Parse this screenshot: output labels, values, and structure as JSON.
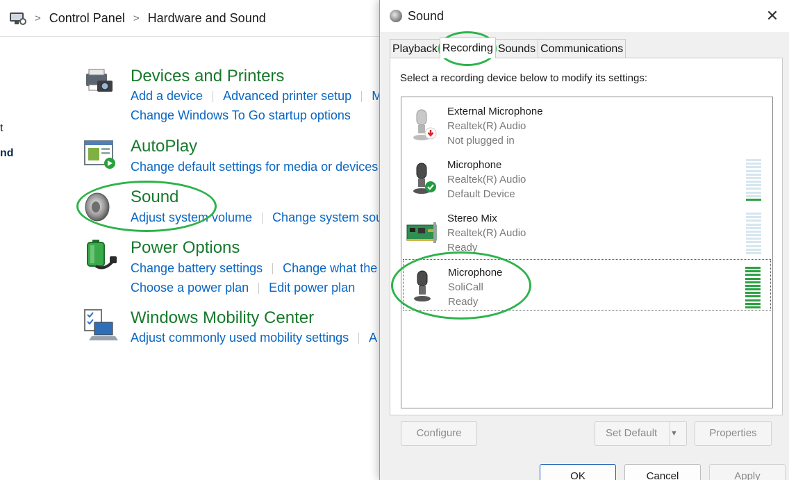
{
  "control_panel": {
    "breadcrumb": [
      "Control Panel",
      "Hardware and Sound"
    ],
    "sidebar_fragments": [
      "t",
      "nd"
    ],
    "categories": [
      {
        "title": "Devices and Printers",
        "links": [
          [
            "Add a device",
            "Advanced printer setup",
            "M"
          ],
          [
            "Change Windows To Go startup options"
          ]
        ]
      },
      {
        "title": "AutoPlay",
        "links": [
          [
            "Change default settings for media or devices"
          ]
        ]
      },
      {
        "title": "Sound",
        "links": [
          [
            "Adjust system volume",
            "Change system sou"
          ]
        ]
      },
      {
        "title": "Power Options",
        "links": [
          [
            "Change battery settings",
            "Change what the"
          ],
          [
            "Choose a power plan",
            "Edit power plan"
          ]
        ]
      },
      {
        "title": "Windows Mobility Center",
        "links": [
          [
            "Adjust commonly used mobility settings",
            "A"
          ]
        ]
      }
    ]
  },
  "dialog": {
    "title": "Sound",
    "close_glyph": "✕",
    "tabs": [
      "Playback",
      "Recording",
      "Sounds",
      "Communications"
    ],
    "active_tab": "Recording",
    "instruction": "Select a recording device below to modify its settings:",
    "devices": [
      {
        "name": "External Microphone",
        "driver": "Realtek(R) Audio",
        "status": "Not plugged in",
        "icon": "microphone-unplugged-icon"
      },
      {
        "name": "Microphone",
        "driver": "Realtek(R) Audio",
        "status": "Default Device",
        "icon": "microphone-default-icon",
        "level": 0.1
      },
      {
        "name": "Stereo Mix",
        "driver": "Realtek(R) Audio",
        "status": "Ready",
        "icon": "sound-card-icon",
        "level": 0
      },
      {
        "name": "Microphone",
        "driver": "SoliCall",
        "status": "Ready",
        "icon": "microphone-icon",
        "level": 1.0,
        "selected": true
      }
    ],
    "buttons": {
      "configure": "Configure",
      "set_default": "Set Default",
      "properties": "Properties",
      "ok": "OK",
      "cancel": "Cancel",
      "apply": "Apply"
    }
  },
  "colors": {
    "category_title": "#17792c",
    "link": "#0a66c2",
    "annotation_ellipse": "#2db34a",
    "meter_lit": "#2ea043",
    "meter_unlit": "#d6e6ef"
  }
}
